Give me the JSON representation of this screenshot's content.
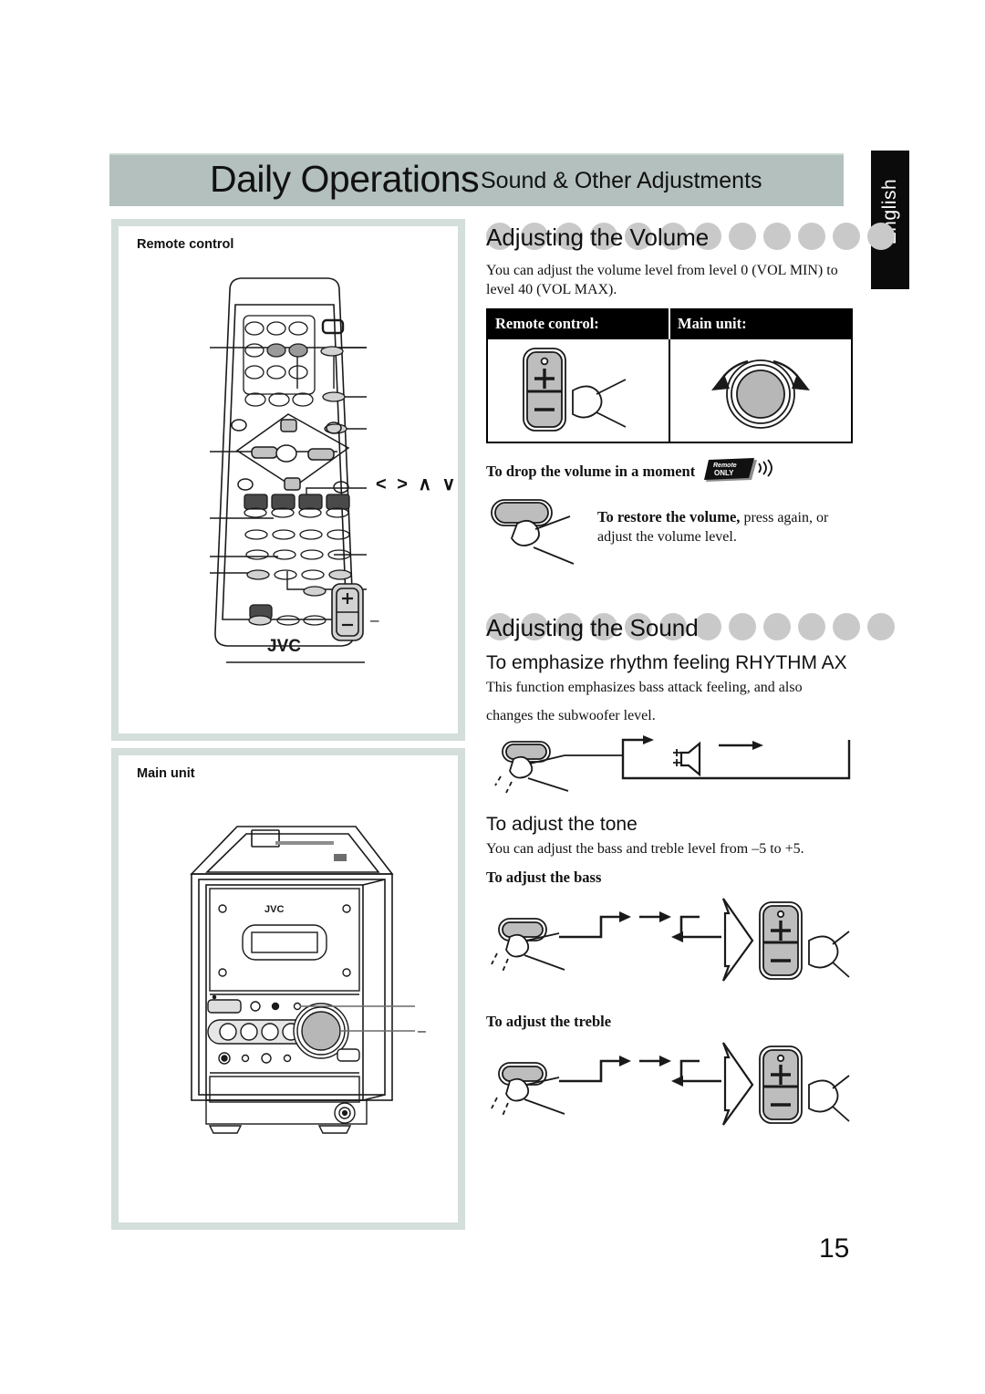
{
  "header": {
    "title_main": "Daily Operations",
    "title_sub": "Sound & Other Adjustments",
    "language_tab": "English",
    "bar_color": "#b3c0bd"
  },
  "page_number": "15",
  "left_column": {
    "panels": [
      {
        "label": "Remote control",
        "callout_label": "< > ∧ ∨",
        "brand": "JVC"
      },
      {
        "label": "Main unit",
        "brand": "JVC"
      }
    ]
  },
  "right_column": {
    "volume_section": {
      "heading": "Adjusting the Volume",
      "dot_count": 6,
      "body": "You can adjust the volume level from level 0 (VOL MIN) to level 40 (VOL MAX).",
      "table": {
        "headers": [
          "Remote control:",
          "Main unit:"
        ],
        "cells": [
          "volume-plus-minus-button-illustration",
          "volume-knob-illustration"
        ]
      },
      "mute_heading": "To drop the volume in a moment",
      "badge": {
        "line1": "Remote",
        "line2": "ONLY"
      },
      "restore_bold": "To restore the volume,",
      "restore_rest": " press again, or",
      "restore_line2": "adjust the volume level."
    },
    "sound_section": {
      "heading": "Adjusting the Sound",
      "dot_count": 6,
      "rhythm_heading": "To emphasize rhythm feeling RHYTHM AX",
      "rhythm_body_line1": "This function emphasizes bass attack feeling, and also",
      "rhythm_body_line2": "changes the subwoofer level.",
      "tone_heading": "To adjust the tone",
      "tone_body": "You can adjust the bass and treble level from –5 to +5.",
      "bass_heading": "To adjust the bass",
      "treble_heading": "To adjust the treble"
    }
  },
  "colors": {
    "panel_border": "#d4dedb",
    "dot_gray": "#c9c9c9",
    "header_band": "#b3c0bd",
    "tab_black": "#0b0b0b"
  }
}
